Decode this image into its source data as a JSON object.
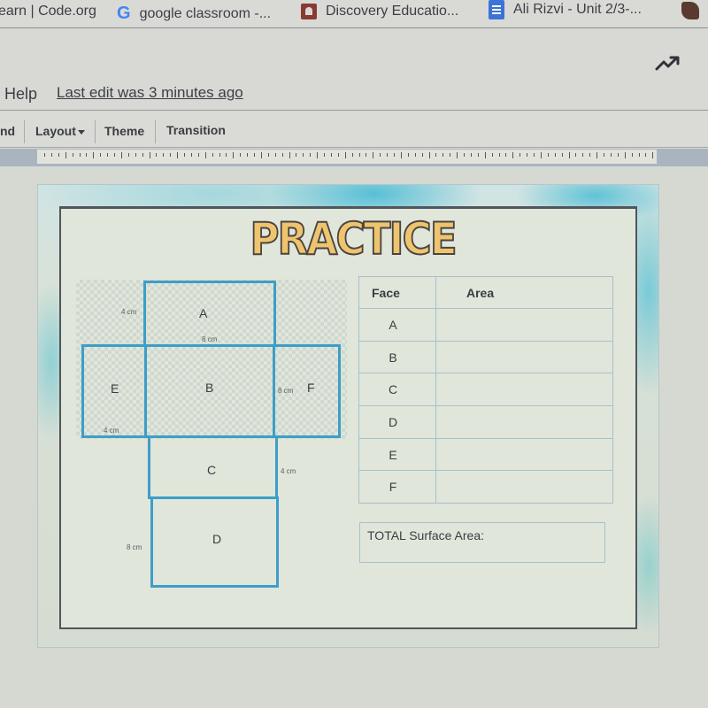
{
  "bookmarks": [
    {
      "label": "earn | Code.org",
      "icon": "none"
    },
    {
      "label": "google classroom -...",
      "icon": "google-g-icon"
    },
    {
      "label": "Discovery Educatio...",
      "icon": "discovery-education-icon"
    },
    {
      "label": "Ali Rizvi - Unit 2/3-...",
      "icon": "google-docs-icon"
    }
  ],
  "header": {
    "menu_help": "Help",
    "last_edit": "Last edit was 3 minutes ago",
    "activity_icon": "trending-up-icon"
  },
  "toolbar": {
    "items": [
      "nd",
      "Layout",
      "Theme",
      "Transition"
    ]
  },
  "slide": {
    "title": "PRACTICE",
    "net": {
      "faces": [
        "A",
        "B",
        "C",
        "D",
        "E",
        "F"
      ],
      "dimensions": {
        "a_side": "4 cm",
        "a_bottom": "8 cm",
        "f_side": "8 cm",
        "e_bottom": "4 cm",
        "c_side": "4 cm",
        "d_side": "8 cm"
      }
    },
    "table": {
      "headers": [
        "Face",
        "Area"
      ],
      "rows": [
        {
          "face": "A",
          "area": ""
        },
        {
          "face": "B",
          "area": ""
        },
        {
          "face": "C",
          "area": ""
        },
        {
          "face": "D",
          "area": ""
        },
        {
          "face": "E",
          "area": ""
        },
        {
          "face": "F",
          "area": ""
        }
      ]
    },
    "total_label": "TOTAL Surface Area:",
    "total_value": ""
  },
  "colors": {
    "net_line": "#3d9ec8",
    "title_fill": "#efc46e",
    "table_border": "#a8bfd0"
  }
}
